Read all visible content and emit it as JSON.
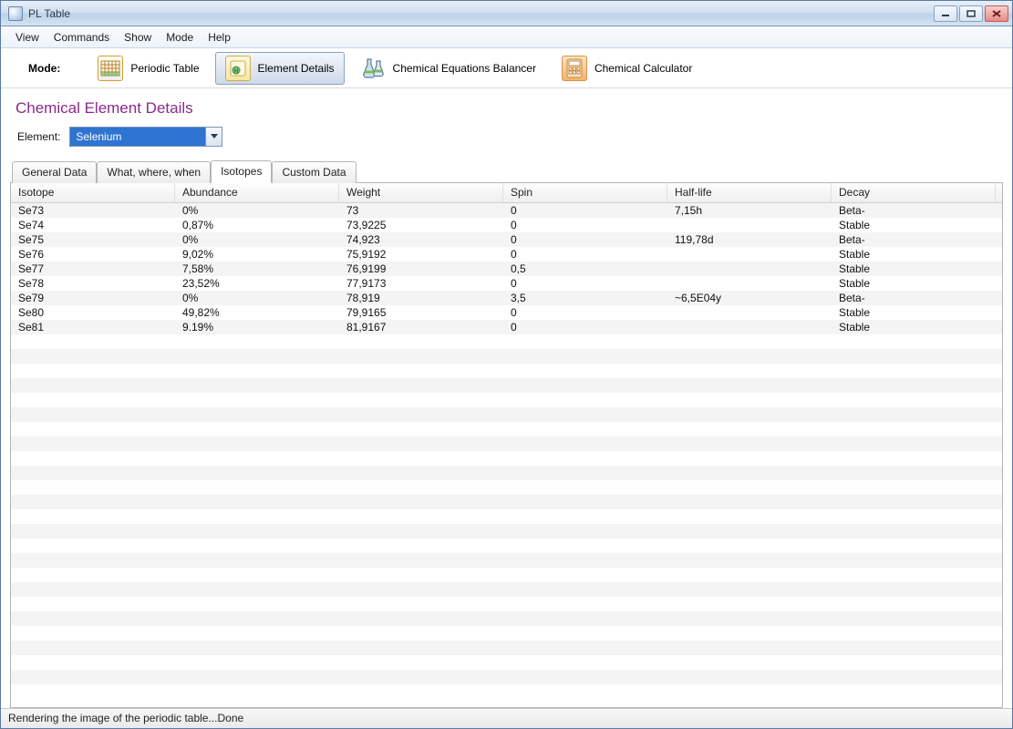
{
  "window": {
    "title": "PL Table"
  },
  "menu": {
    "items": [
      "View",
      "Commands",
      "Show",
      "Mode",
      "Help"
    ]
  },
  "toolbar": {
    "mode_label": "Mode:",
    "buttons": [
      {
        "label": "Periodic Table",
        "icon": "periodic-grid"
      },
      {
        "label": "Element Details",
        "icon": "element-detail",
        "active": true
      },
      {
        "label": "Chemical Equations Balancer",
        "icon": "flask"
      },
      {
        "label": "Chemical Calculator",
        "icon": "calculator"
      }
    ]
  },
  "section": {
    "title": "Chemical Element Details"
  },
  "element_select": {
    "label": "Element:",
    "value": "Selenium"
  },
  "tabs": {
    "items": [
      "General Data",
      "What, where, when",
      "Isotopes",
      "Custom Data"
    ],
    "active_index": 2
  },
  "table": {
    "columns": [
      "Isotope",
      "Abundance",
      "Weight",
      "Spin",
      "Half-life",
      "Decay"
    ],
    "rows": [
      [
        "Se73",
        "0%",
        "73",
        "0",
        "7,15h",
        "Beta-"
      ],
      [
        "Se74",
        "0,87%",
        "73,9225",
        "0",
        "",
        "Stable"
      ],
      [
        "Se75",
        "0%",
        "74,923",
        "0",
        "119,78d",
        "Beta-"
      ],
      [
        "Se76",
        "9,02%",
        "75,9192",
        "0",
        "",
        "Stable"
      ],
      [
        "Se77",
        "7,58%",
        "76,9199",
        "0,5",
        "",
        "Stable"
      ],
      [
        "Se78",
        "23,52%",
        "77,9173",
        "0",
        "",
        "Stable"
      ],
      [
        "Se79",
        "0%",
        "78,919",
        "3,5",
        "~6,5E04y",
        "Beta-"
      ],
      [
        "Se80",
        "49,82%",
        "79,9165",
        "0",
        "",
        "Stable"
      ],
      [
        "Se81",
        "9.19%",
        "81,9167",
        "0",
        "",
        "Stable"
      ]
    ],
    "empty_rows": 25
  },
  "status": {
    "text": "Rendering the image of the periodic table...Done"
  }
}
